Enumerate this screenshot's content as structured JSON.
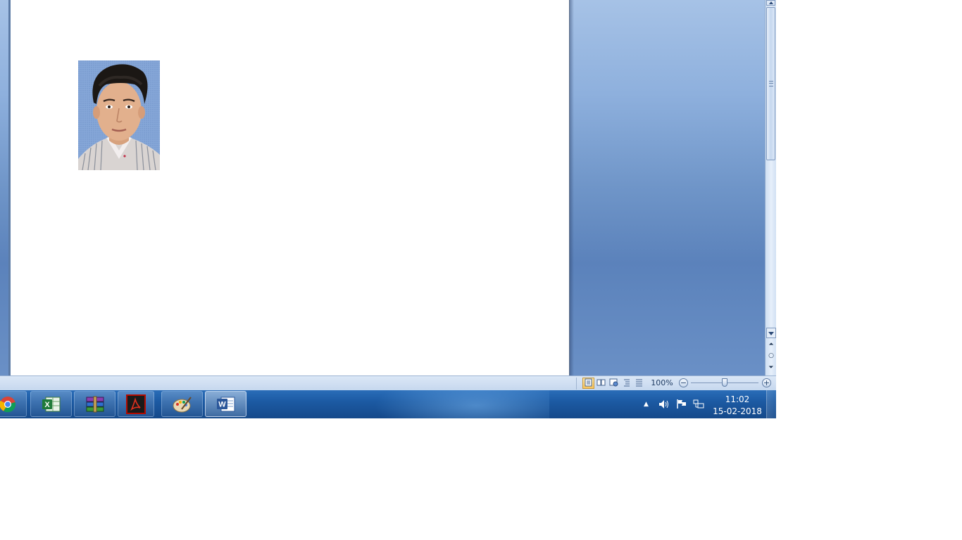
{
  "document": {
    "image_name": "passport-photo"
  },
  "statusbar": {
    "view_buttons": [
      "print-layout",
      "full-screen-reading",
      "web-layout",
      "outline",
      "draft"
    ],
    "zoom_level": "100%",
    "zoom_out_symbol": "−",
    "zoom_in_symbol": "+"
  },
  "scrollbar": {
    "prev_symbol": "⏶",
    "browse_symbol": "○",
    "next_symbol": "⏷"
  },
  "taskbar": {
    "apps": [
      "chrome-icon",
      "excel-icon",
      "winrar-icon",
      "acrobat-icon",
      "paint-icon",
      "word-icon"
    ],
    "active_app": "word-icon",
    "accent": "#1c5aa3"
  },
  "tray": {
    "show_hidden": "▲",
    "volume_icon": "speaker-icon",
    "flag_icon": "action-center-flag-icon",
    "network_icon": "network-icon",
    "time": "11:02",
    "date": "15-02-2018"
  }
}
